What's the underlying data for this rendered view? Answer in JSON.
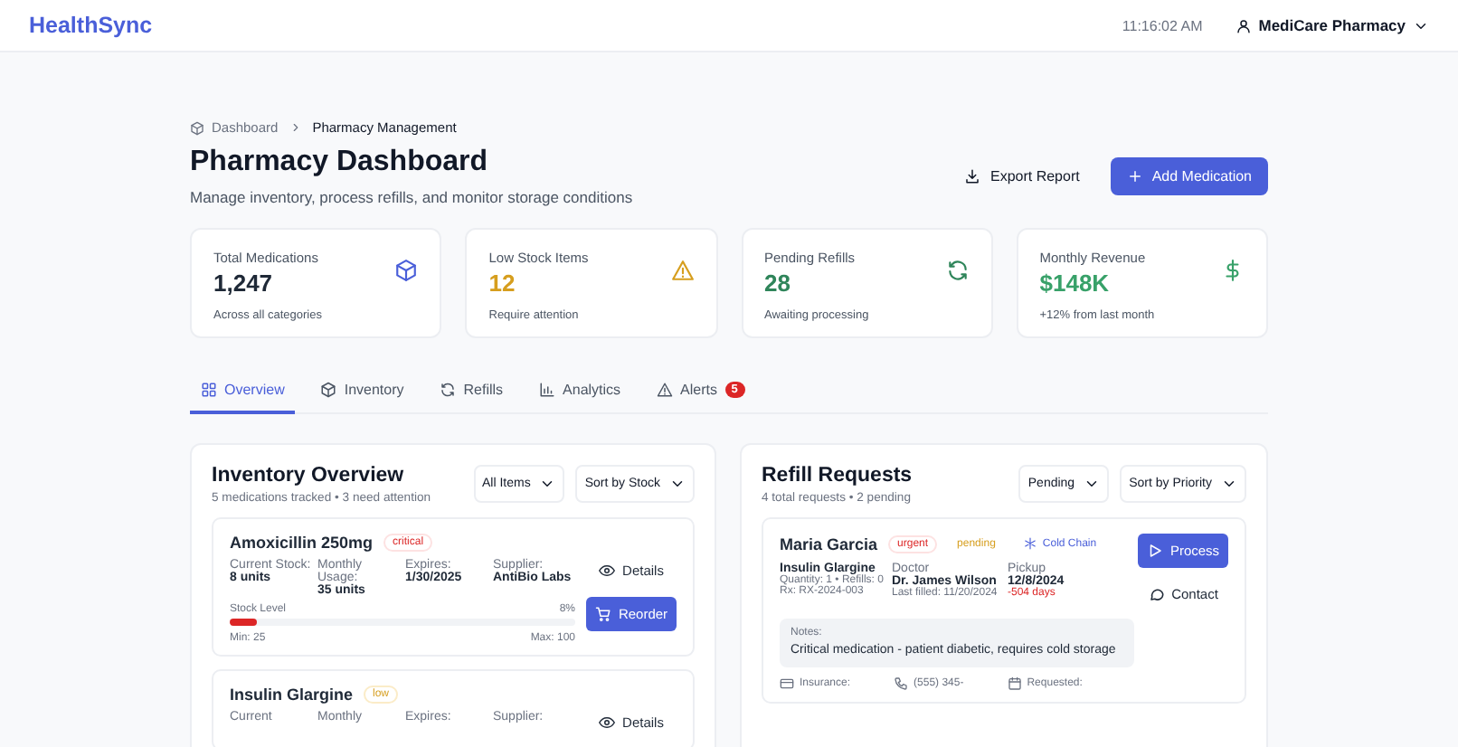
{
  "header": {
    "logo": "HealthSync",
    "time": "11:16:02 AM",
    "user": "MediCare Pharmacy"
  },
  "breadcrumb": [
    "Dashboard",
    "Pharmacy Management"
  ],
  "page": {
    "title": "Pharmacy Dashboard",
    "subtitle": "Manage inventory, process refills, and monitor storage conditions"
  },
  "actions": [
    {
      "label": "Export Report",
      "kind": "export"
    },
    {
      "label": "Add Medication",
      "kind": "add"
    }
  ],
  "stats": [
    {
      "label": "Total Medications",
      "value": "1,247",
      "note": "Across all categories",
      "kind": "box",
      "color": "#1f2937"
    },
    {
      "label": "Low Stock Items",
      "value": "12",
      "note": "Require attention",
      "kind": "warning",
      "color": "#d69e1e"
    },
    {
      "label": "Pending Refills",
      "value": "28",
      "note": "Awaiting processing",
      "kind": "refresh",
      "color": "#2f855a"
    },
    {
      "label": "Monthly Revenue",
      "value": "$148K",
      "note": "+12% from last month",
      "kind": "dollar",
      "color": "#38a169"
    }
  ],
  "tabs": [
    {
      "label": "Overview",
      "kind": "grid",
      "selected": true
    },
    {
      "label": "Inventory",
      "kind": "box",
      "selected": false
    },
    {
      "label": "Refills",
      "kind": "refresh",
      "selected": false
    },
    {
      "label": "Analytics",
      "kind": "chart",
      "selected": false
    },
    {
      "label": "Alerts",
      "kind": "warning",
      "selected": false,
      "badge": "5"
    }
  ],
  "inventory": {
    "title": "Inventory Overview",
    "subtitle": "5 medications tracked • 3 need attention",
    "filter": "All Items",
    "sort": "Sort by Stock",
    "items": [
      {
        "name": "Amoxicillin 250mg",
        "tag": {
          "label": "critical",
          "kind": "critical"
        },
        "fields": [
          {
            "label": "Current Stock:",
            "value": "8 units"
          },
          {
            "label": "Monthly Usage:",
            "value": "35 units"
          },
          {
            "label": "Expires:",
            "value": "1/30/2025"
          },
          {
            "label": "Supplier:",
            "value": "AntiBio Labs"
          }
        ],
        "details": "Details",
        "reorder": "Reorder",
        "stock_label": "Stock Level",
        "stock_percent": "8%",
        "level": 0.08,
        "min": "Min: 25",
        "max": "Max: 100"
      },
      {
        "name": "Insulin Glargine",
        "tag": {
          "label": "low",
          "kind": "low"
        },
        "fields": [
          {
            "label": "Current"
          },
          {
            "label": "Monthly"
          },
          {
            "label": "Expires:"
          },
          {
            "label": "Supplier:"
          }
        ],
        "details": "Details"
      }
    ]
  },
  "refills": {
    "title": "Refill Requests",
    "subtitle": "4 total requests • 2 pending",
    "filter": "Pending",
    "sort": "Sort by Priority",
    "items": [
      {
        "patient": "Maria Garcia",
        "tags": [
          {
            "label": "urgent",
            "kind": "urgent"
          },
          {
            "label": "pending",
            "kind": "pending"
          },
          {
            "label": "Cold Chain",
            "kind": "cold"
          }
        ],
        "medication": "Insulin Glargine",
        "quantity": "Quantity: 1 • Refills: 0",
        "rx": "Rx: RX-2024-003",
        "doctor_label": "Doctor",
        "doctor": "Dr. James Wilson",
        "last_filled": "Last filled: 11/20/2024",
        "pickup_label": "Pickup",
        "pickup": "12/8/2024",
        "overdue": "-504 days",
        "notes_label": "Notes:",
        "notes": "Critical medication - patient diabetic, requires cold storage",
        "process": "Process",
        "contact": "Contact",
        "footer": [
          {
            "text": "Insurance:",
            "kind": "card"
          },
          {
            "text": "(555) 345-",
            "kind": "phone"
          },
          {
            "text": "Requested:",
            "kind": "calendar"
          }
        ]
      }
    ]
  }
}
